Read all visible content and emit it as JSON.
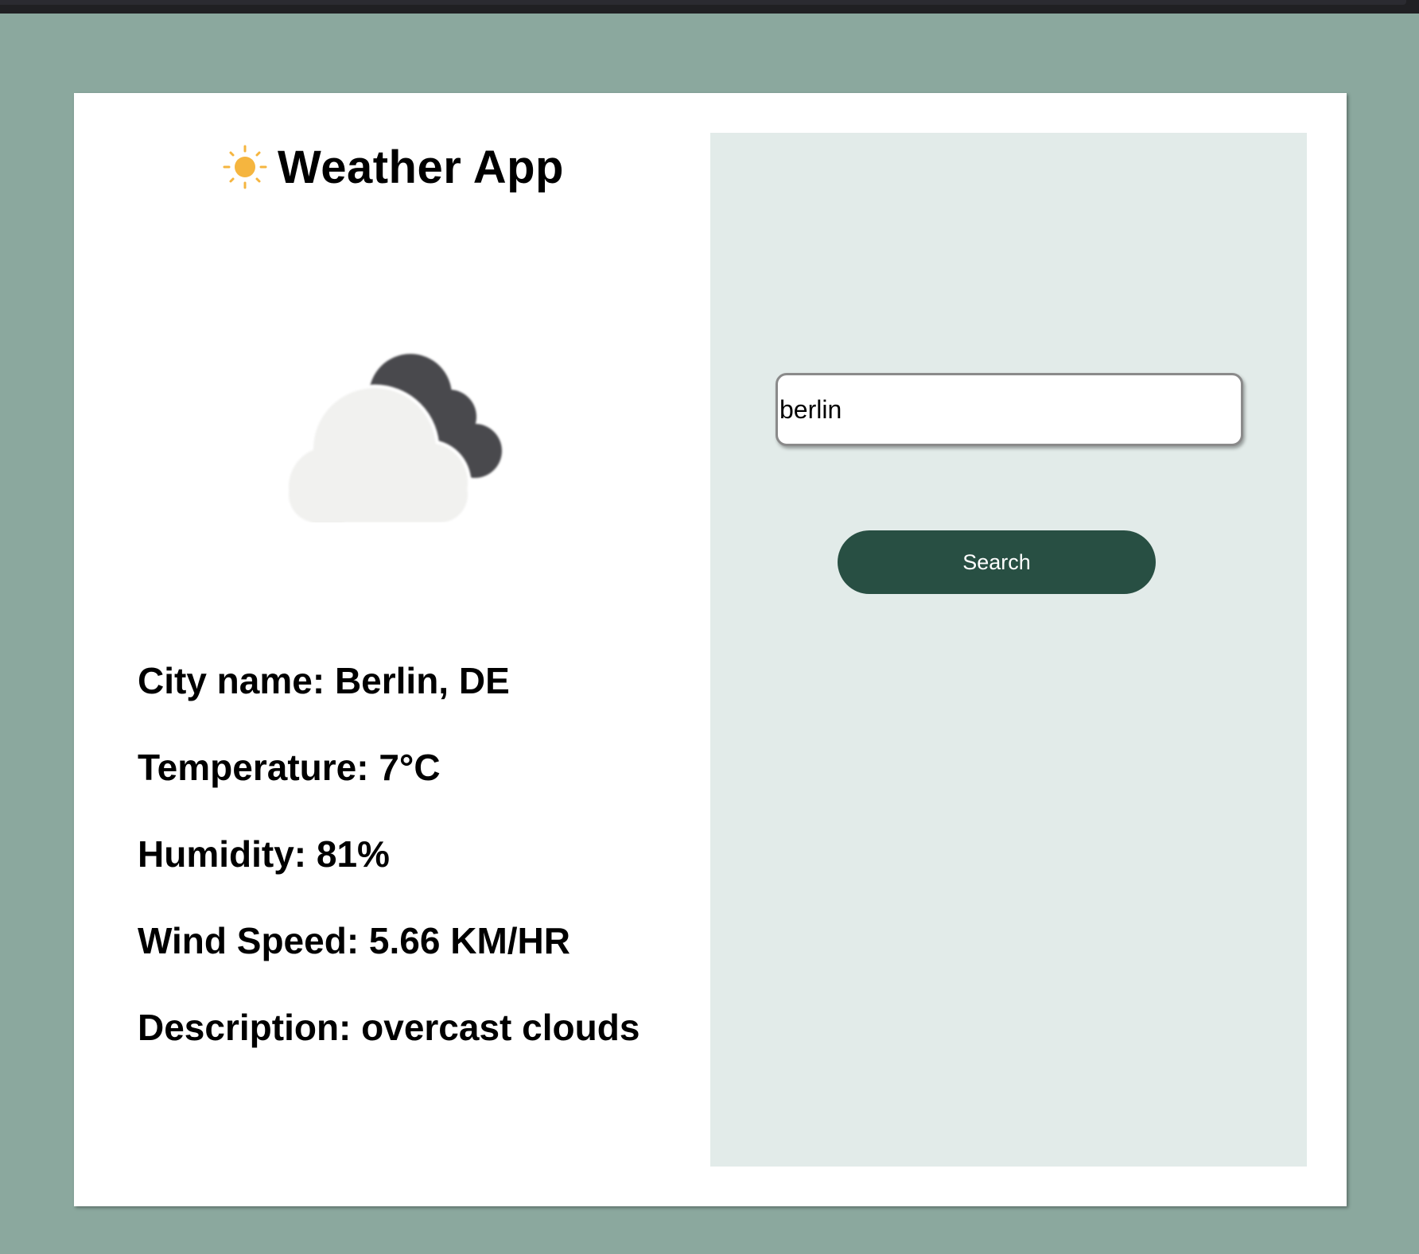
{
  "app": {
    "title": "Weather App",
    "title_icon": "sun-icon",
    "weather_icon": "overcast-clouds-icon"
  },
  "search": {
    "value": "berlin",
    "button_label": "Search"
  },
  "weather": {
    "city": "City name: Berlin, DE",
    "temperature": "Temperature: 7°C",
    "humidity": "Humidity: 81%",
    "wind_speed": "Wind Speed: 5.66 KM/HR",
    "description": "Description: overcast clouds"
  },
  "colors": {
    "page_background": "#8ba89e",
    "card_background": "#ffffff",
    "search_panel_background": "#e2ebe9",
    "button_background": "#284f43",
    "button_text": "#ffffff",
    "sun_color": "#f5b53f"
  }
}
